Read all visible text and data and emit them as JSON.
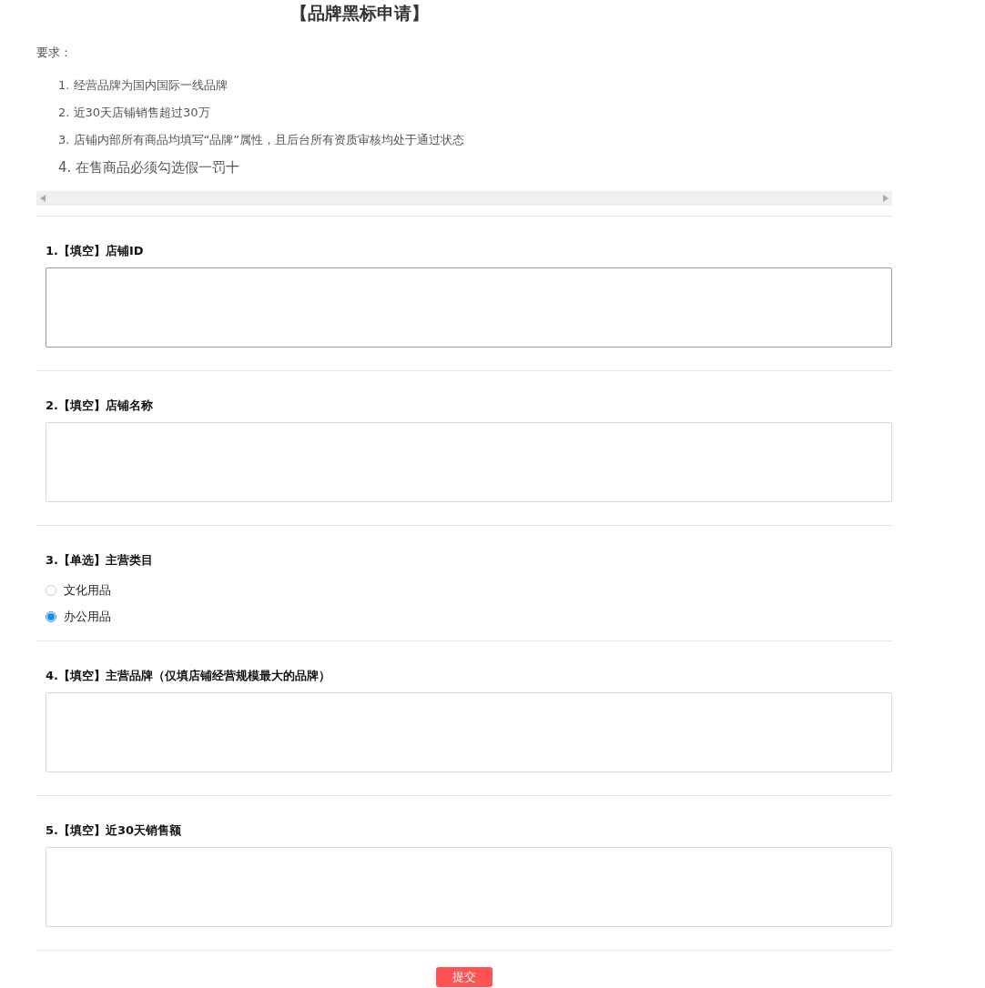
{
  "title": "【品牌黑标申请】",
  "requirements": {
    "heading": "要求：",
    "items": [
      {
        "text": "1. 经营品牌为国内国际一线品牌",
        "large": false
      },
      {
        "text": "2. 近30天店铺销售超过30万",
        "large": false
      },
      {
        "text": "3. 店铺内部所有商品均填写“品牌”属性，且后台所有资质审核均处于通过状态",
        "large": false
      },
      {
        "text": "4. 在售商品必须勾选假一罚十",
        "large": true
      }
    ]
  },
  "questions": [
    {
      "kind": "text",
      "label": "1.【填空】店铺ID",
      "focused": true
    },
    {
      "kind": "text",
      "label": "2.【填空】店铺名称",
      "focused": false
    },
    {
      "kind": "radio",
      "label": "3.【单选】主营类目",
      "options": [
        {
          "label": "文化用品",
          "selected": false
        },
        {
          "label": "办公用品",
          "selected": true
        }
      ]
    },
    {
      "kind": "text",
      "label": "4.【填空】主营品牌（仅填店铺经营规模最大的品牌）",
      "focused": false
    },
    {
      "kind": "text",
      "label": "5.【填空】近30天销售额",
      "focused": false
    }
  ],
  "submit": "提交"
}
